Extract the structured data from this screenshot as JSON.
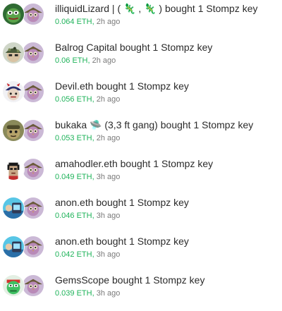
{
  "activity": [
    {
      "buyer_name": "illiquidLizard | ( 🦎 , 🦎 )",
      "action_text": "bought 1 Stompz key",
      "price": "0.064 ETH",
      "time_ago": "2h ago",
      "buyer_avatar_icon": "pepe-avatar",
      "subject_avatar_icon": "stompz-owl-avatar"
    },
    {
      "buyer_name": "Balrog Capital",
      "action_text": "bought 1 Stompz key",
      "price": "0.06 ETH",
      "time_ago": "2h ago",
      "buyer_avatar_icon": "camo-helmet-avatar",
      "subject_avatar_icon": "stompz-owl-avatar"
    },
    {
      "buyer_name": "Devil.eth",
      "action_text": "bought 1 Stompz key",
      "price": "0.056 ETH",
      "time_ago": "2h ago",
      "buyer_avatar_icon": "devil-cap-avatar",
      "subject_avatar_icon": "stompz-owl-avatar"
    },
    {
      "buyer_name": "bukaka 🛸 (3,3 ft gang)",
      "action_text": "bought 1 Stompz key",
      "price": "0.053 ETH",
      "time_ago": "2h ago",
      "buyer_avatar_icon": "olive-character-avatar",
      "subject_avatar_icon": "stompz-owl-avatar"
    },
    {
      "buyer_name": "amahodler.eth",
      "action_text": "bought 1 Stompz key",
      "price": "0.049 ETH",
      "time_ago": "3h ago",
      "buyer_avatar_icon": "pixel-punk-avatar",
      "subject_avatar_icon": "stompz-owl-avatar"
    },
    {
      "buyer_name": "anon.eth",
      "action_text": "bought 1 Stompz key",
      "price": "0.046 ETH",
      "time_ago": "3h ago",
      "buyer_avatar_icon": "anon-cyan-avatar",
      "subject_avatar_icon": "stompz-owl-avatar"
    },
    {
      "buyer_name": "anon.eth",
      "action_text": "bought 1 Stompz key",
      "price": "0.042 ETH",
      "time_ago": "3h ago",
      "buyer_avatar_icon": "anon-cyan-avatar",
      "subject_avatar_icon": "stompz-owl-avatar"
    },
    {
      "buyer_name": "GemsScope",
      "action_text": "bought 1 Stompz key",
      "price": "0.039 ETH",
      "time_ago": "3h ago",
      "buyer_avatar_icon": "green-frog-avatar",
      "subject_avatar_icon": "stompz-owl-avatar"
    }
  ],
  "colors": {
    "price_green": "#1fb35a",
    "text_dark": "#2b2b2b",
    "time_gray": "#7a7a7a"
  }
}
